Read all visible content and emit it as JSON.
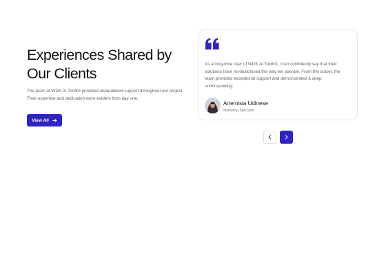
{
  "hero": {
    "title": "Experiences Shared by Our Clients",
    "description": "The team at WDK AI ToolKit provided unparalleled support throughout our project. Their expertise and dedication were evident from day one.",
    "view_all_label": "View All"
  },
  "testimonial": {
    "quote": "As a long-time user of WDK AI ToolKit, I can confidently say that their solutions have revolutionised the way we operate. From the outset, the team provided exceptional support and demonstrated a deep understanding.",
    "author_name": "Artemisia Udinese",
    "author_role": "Marketing Specialist"
  },
  "icons": {
    "quote": "quote-icon",
    "view_all": "arrow-right-icon",
    "previous": "chevron-left-icon",
    "next": "chevron-right-icon"
  },
  "colors": {
    "accent": "#2f24c2",
    "heading": "#111111",
    "body_text": "#666666",
    "card_border": "#e5e5ea"
  }
}
